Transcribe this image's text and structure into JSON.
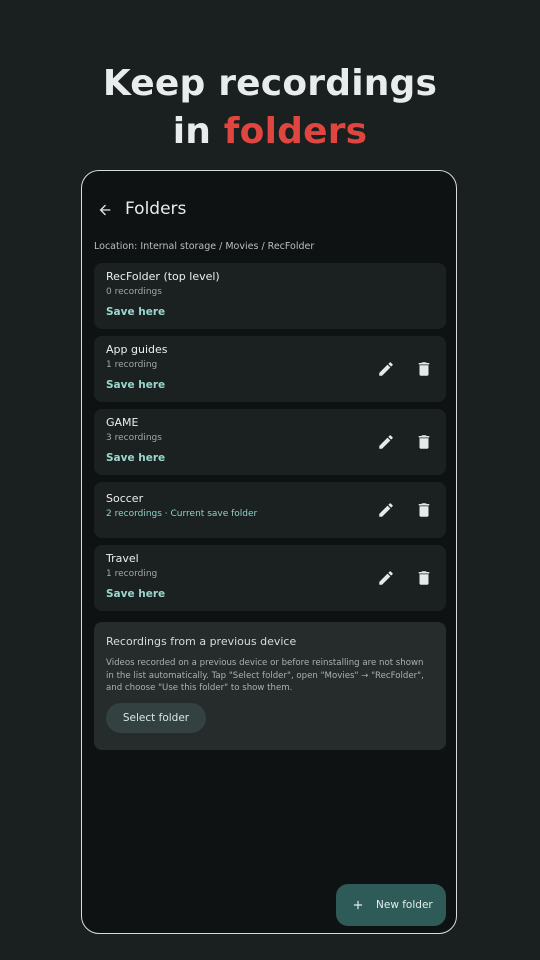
{
  "promo": {
    "line1": "Keep recordings",
    "line2_prefix": "in ",
    "line2_accent": "folders"
  },
  "appbar": {
    "title": "Folders",
    "back_icon": "arrow-left-icon"
  },
  "location": "Location: Internal storage / Movies / RecFolder",
  "folders": [
    {
      "name": "RecFolder (top level)",
      "count": "0 recordings",
      "action": "Save here",
      "editable": false
    },
    {
      "name": "App guides",
      "count": "1 recording",
      "action": "Save here",
      "editable": true
    },
    {
      "name": "GAME",
      "count": "3 recordings",
      "action": "Save here",
      "editable": true
    },
    {
      "name": "Soccer",
      "count": "2 recordings · Current save folder",
      "action": "",
      "editable": true,
      "current": true
    },
    {
      "name": "Travel",
      "count": "1 recording",
      "action": "Save here",
      "editable": true
    }
  ],
  "info": {
    "title": "Recordings from a previous device",
    "body": "Videos recorded on a previous device or before reinstalling are not shown in the list automatically. Tap \"Select folder\", open \"Movies\" → \"RecFolder\", and choose \"Use this folder\" to show them.",
    "button": "Select folder"
  },
  "fab": {
    "label": "New folder",
    "icon": "plus-icon"
  },
  "colors": {
    "accent": "#e0463f",
    "teal_text": "#9bd8cf",
    "fab_bg": "#2e5b57"
  }
}
